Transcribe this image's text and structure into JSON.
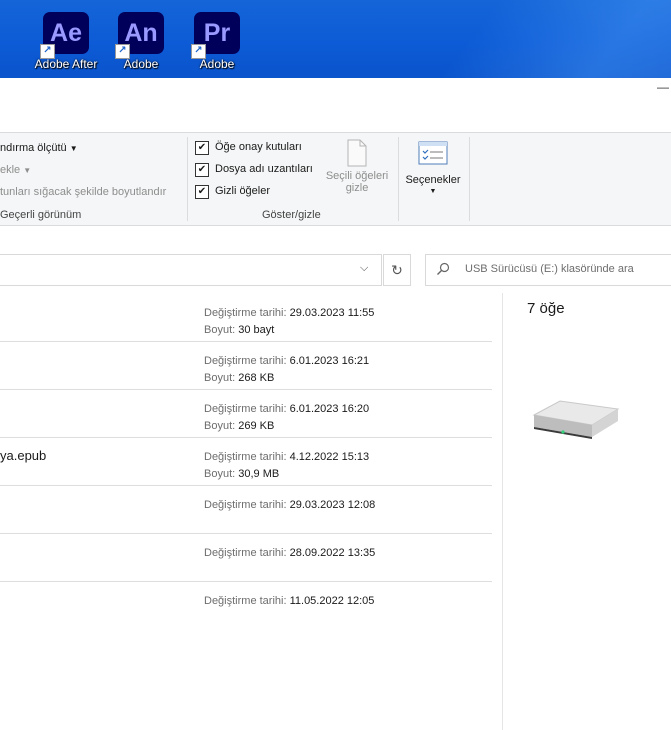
{
  "desktop": {
    "icons": [
      {
        "abbr": "Ae",
        "label": "Adobe After",
        "color": "#9999ff"
      },
      {
        "abbr": "An",
        "label": "Adobe",
        "color": "#9999ff"
      },
      {
        "abbr": "Pr",
        "label": "Adobe",
        "color": "#9999ff"
      }
    ],
    "background_color": "#0d5bd6"
  },
  "window": {
    "minimize_glyph": "—"
  },
  "ribbon": {
    "sort_label": "ndırma ölçütü",
    "add_label": "ekle",
    "size_columns_label": "tunları sığacak şekilde boyutlandır",
    "current_view_group": "Geçerli görünüm",
    "checkbox_item_label": "Öğe onay kutuları",
    "file_ext_label": "Dosya adı uzantıları",
    "hidden_items_label": "Gizli öğeler",
    "hide_selected_line1": "Seçili öğeleri",
    "hide_selected_line2": "gizle",
    "show_hide_group": "Göster/gizle",
    "options_label": "Seçenekler",
    "options_icon": "options-list-icon"
  },
  "address": {
    "refresh_glyph": "↻",
    "chevron_glyph": "⌵",
    "search_placeholder": "USB Sürücüsü (E:) klasöründe ara"
  },
  "files": [
    {
      "name": "",
      "modified_label": "Değiştirme tarihi:",
      "modified": "29.03.2023 11:55",
      "size_label": "Boyut:",
      "size": "30 bayt"
    },
    {
      "name": "",
      "modified_label": "Değiştirme tarihi:",
      "modified": "6.01.2023 16:21",
      "size_label": "Boyut:",
      "size": "268 KB"
    },
    {
      "name": "",
      "modified_label": "Değiştirme tarihi:",
      "modified": "6.01.2023 16:20",
      "size_label": "Boyut:",
      "size": "269 KB"
    },
    {
      "name": "ya.epub",
      "modified_label": "Değiştirme tarihi:",
      "modified": "4.12.2022 15:13",
      "size_label": "Boyut:",
      "size": "30,9 MB"
    },
    {
      "name": "",
      "modified_label": "Değiştirme tarihi:",
      "modified": "29.03.2023 12:08"
    },
    {
      "name": "",
      "modified_label": "Değiştirme tarihi:",
      "modified": "28.09.2022 13:35"
    },
    {
      "name": "",
      "modified_label": "Değiştirme tarihi:",
      "modified": "11.05.2022 12:05"
    }
  ],
  "details": {
    "item_count": "7 öğe",
    "icon": "usb-drive-icon"
  }
}
